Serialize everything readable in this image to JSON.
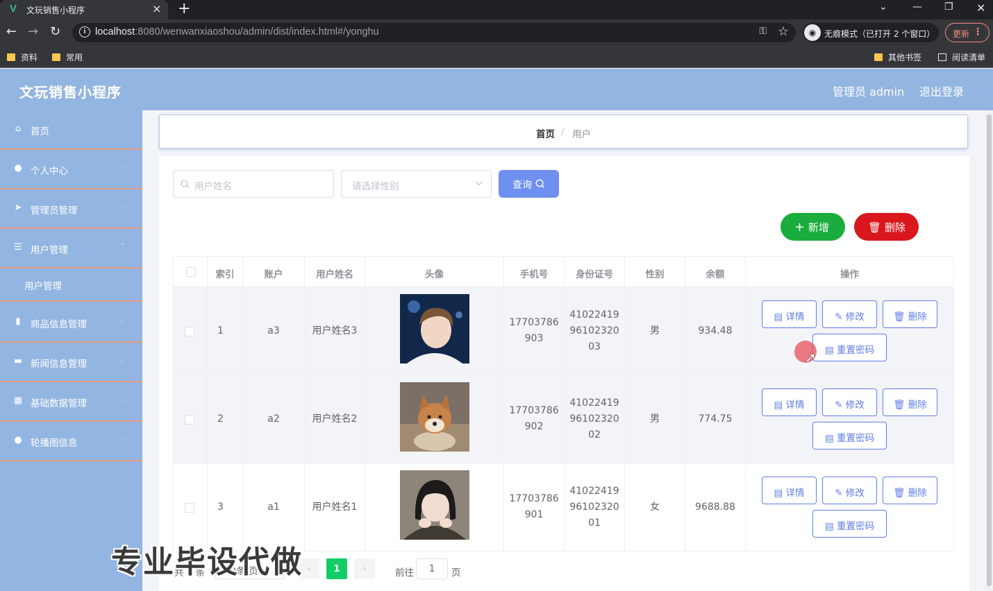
{
  "browser": {
    "tab_title": "文玩销售小程序",
    "tab_favicon": "V",
    "url_host": "localhost",
    "url_rest": ":8080/wenwanxiaoshou/admin/dist/index.html#/yonghu",
    "incognito_label": "无痕模式（已打开 2 个窗口）",
    "update_label": "更新",
    "bookmarks": [
      "资料",
      "常用"
    ],
    "bookmarks_right": [
      "其他书签",
      "阅读清单"
    ]
  },
  "header": {
    "title": "文玩销售小程序",
    "admin_label": "管理员 admin",
    "logout_label": "退出登录"
  },
  "sidebar": {
    "items": [
      {
        "label": "首页",
        "icon": "home-icon"
      },
      {
        "label": "个人中心",
        "icon": "user-icon"
      },
      {
        "label": "管理员管理",
        "icon": "send-icon"
      },
      {
        "label": "用户管理",
        "icon": "list-icon"
      },
      {
        "label": "商品信息管理",
        "icon": "chart-icon"
      },
      {
        "label": "新闻信息管理",
        "icon": "monitor-icon"
      },
      {
        "label": "基础数据管理",
        "icon": "grid-icon"
      },
      {
        "label": "轮播图信息",
        "icon": "user-icon"
      }
    ],
    "sub_item": "用户管理"
  },
  "breadcrumb": {
    "home": "首页",
    "sep": "/",
    "current": "用户"
  },
  "search": {
    "name_placeholder": "用户姓名",
    "gender_placeholder": "请选择性别",
    "query_label": "查询"
  },
  "actions": {
    "add_label": "新增",
    "delete_label": "删除"
  },
  "table": {
    "headers": [
      "索引",
      "账户",
      "用户姓名",
      "头像",
      "手机号",
      "身份证号",
      "性别",
      "余额",
      "操作"
    ],
    "rows": [
      {
        "index": "1",
        "account": "a3",
        "name": "用户姓名3",
        "phone1": "17703786",
        "phone2": "903",
        "id1": "41022419",
        "id2": "96102320",
        "id3": "03",
        "gender": "男",
        "balance": "934.48"
      },
      {
        "index": "2",
        "account": "a2",
        "name": "用户姓名2",
        "phone1": "17703786",
        "phone2": "902",
        "id1": "41022419",
        "id2": "96102320",
        "id3": "02",
        "gender": "男",
        "balance": "774.75"
      },
      {
        "index": "3",
        "account": "a1",
        "name": "用户姓名1",
        "phone1": "17703786",
        "phone2": "901",
        "id1": "41022419",
        "id2": "96102320",
        "id3": "01",
        "gender": "女",
        "balance": "9688.88"
      }
    ],
    "row_buttons": {
      "detail": "详情",
      "edit": "修改",
      "delete": "删除",
      "reset": "重置密码"
    }
  },
  "pager": {
    "total": "共 3 条",
    "page_size": "10条/页",
    "current_page": "1",
    "goto_label": "前往",
    "goto_value": "1",
    "page_unit": "页"
  },
  "watermark": "专业毕设代做",
  "colors": {
    "header_bg": "#93b5e1",
    "primary": "#6f8ff1",
    "success": "#1aac3d",
    "danger": "#d9171c",
    "pager_active": "#13ce66"
  }
}
